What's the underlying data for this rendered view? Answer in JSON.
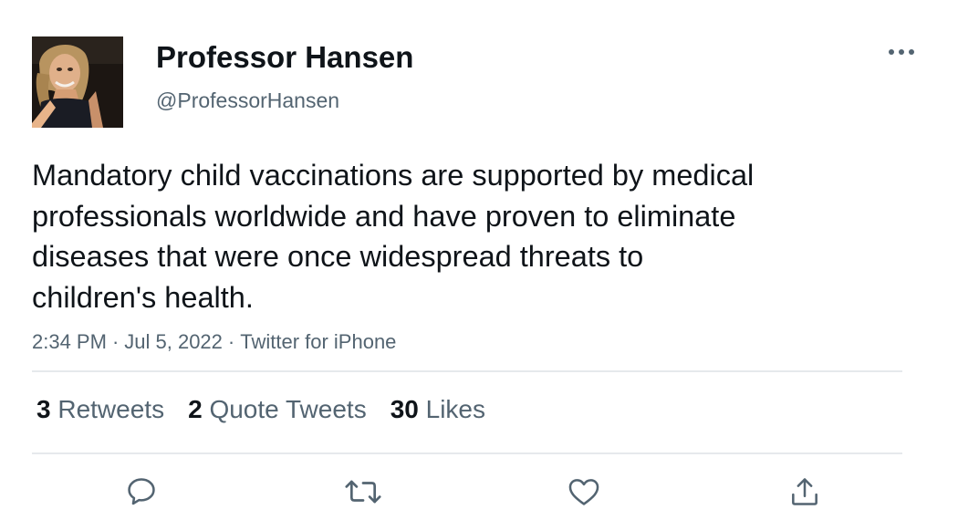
{
  "author": {
    "display_name": "Professor Hansen",
    "handle": "@ProfessorHansen"
  },
  "tweet": {
    "text": "Mandatory child vaccinations are supported by medical\nprofessionals worldwide and have proven to eliminate\ndiseases that were once widespread threats to\nchildren's health.",
    "time": "2:34 PM",
    "date": "Jul 5, 2022",
    "source": "Twitter for iPhone",
    "separator": "·"
  },
  "stats": {
    "retweets": {
      "count": "3",
      "label": "Retweets"
    },
    "quote_tweets": {
      "count": "2",
      "label": "Quote Tweets"
    },
    "likes": {
      "count": "30",
      "label": "Likes"
    }
  },
  "actions": {
    "reply_icon": "speech-bubble-icon",
    "retweet_icon": "retweet-arrows-icon",
    "like_icon": "heart-icon",
    "share_icon": "share-upload-icon",
    "more_icon": "ellipsis-icon"
  },
  "colors": {
    "text_primary": "#0f1419",
    "text_secondary": "#536471",
    "divider": "#e6e9ec",
    "background": "#ffffff"
  }
}
